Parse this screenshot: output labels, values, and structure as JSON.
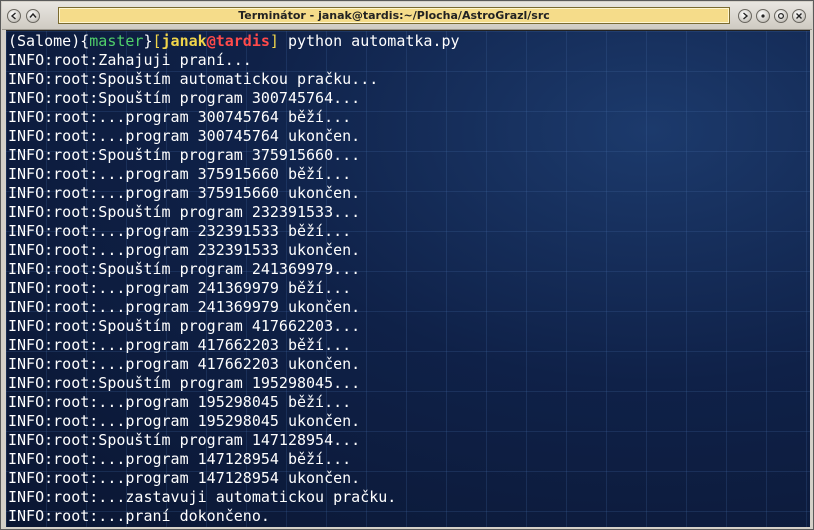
{
  "window": {
    "title": "Terminátor - janak@tardis:~/Plocha/AstroGrazl/src",
    "buttons_left": [
      "menu-icon",
      "shade-icon"
    ],
    "buttons_right": [
      "stick-icon",
      "minimize-icon",
      "maximize-icon",
      "close-icon"
    ]
  },
  "prompt": {
    "venv": "(Salome)",
    "branch_open": "{",
    "branch": "master",
    "branch_close": "}",
    "bracket_open": "[",
    "user": "janak",
    "at": "@",
    "host": "tardis",
    "bracket_close": "]",
    "command": " python automatka.py"
  },
  "colors": {
    "background": "#0d1a3a",
    "text": "#ffffff",
    "branch": "#4fcf6a",
    "user": "#f0d54a",
    "host": "#ff4a4a",
    "title_bar": "#f5dc8a"
  },
  "output": [
    "INFO:root:Zahajuji praní...",
    "INFO:root:Spouštím automatickou pračku...",
    "INFO:root:Spouštím program 300745764...",
    "INFO:root:...program 300745764 běží...",
    "INFO:root:...program 300745764 ukončen.",
    "INFO:root:Spouštím program 375915660...",
    "INFO:root:...program 375915660 běží...",
    "INFO:root:...program 375915660 ukončen.",
    "INFO:root:Spouštím program 232391533...",
    "INFO:root:...program 232391533 běží...",
    "INFO:root:...program 232391533 ukončen.",
    "INFO:root:Spouštím program 241369979...",
    "INFO:root:...program 241369979 běží...",
    "INFO:root:...program 241369979 ukončen.",
    "INFO:root:Spouštím program 417662203...",
    "INFO:root:...program 417662203 běží...",
    "INFO:root:...program 417662203 ukončen.",
    "INFO:root:Spouštím program 195298045...",
    "INFO:root:...program 195298045 běží...",
    "INFO:root:...program 195298045 ukončen.",
    "INFO:root:Spouštím program 147128954...",
    "INFO:root:...program 147128954 běží...",
    "INFO:root:...program 147128954 ukončen.",
    "INFO:root:...zastavuji automatickou pračku.",
    "INFO:root:...praní dokončeno."
  ]
}
